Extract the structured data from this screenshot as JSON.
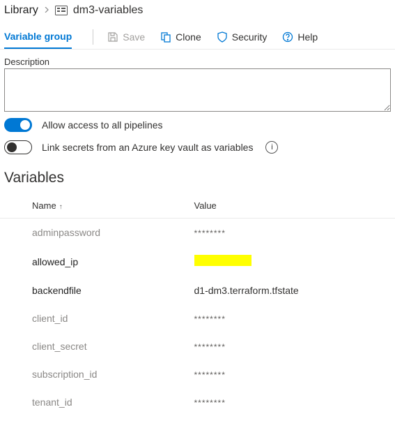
{
  "breadcrumb": {
    "root": "Library",
    "current": "dm3-variables"
  },
  "toolbar": {
    "tab_label": "Variable group",
    "save_label": "Save",
    "clone_label": "Clone",
    "security_label": "Security",
    "help_label": "Help"
  },
  "description": {
    "label": "Description",
    "value": ""
  },
  "toggles": {
    "allow_access": {
      "label": "Allow access to all pipelines",
      "on": true
    },
    "keyvault": {
      "label": "Link secrets from an Azure key vault as variables",
      "on": false
    }
  },
  "variables": {
    "title": "Variables",
    "columns": {
      "name": "Name",
      "value": "Value"
    },
    "rows": [
      {
        "name": "adminpassword",
        "masked": true,
        "value": "********"
      },
      {
        "name": "allowed_ip",
        "masked": false,
        "highlighted": true,
        "value": ""
      },
      {
        "name": "backendfile",
        "masked": false,
        "value": "d1-dm3.terraform.tfstate"
      },
      {
        "name": "client_id",
        "masked": true,
        "value": "********"
      },
      {
        "name": "client_secret",
        "masked": true,
        "value": "********"
      },
      {
        "name": "subscription_id",
        "masked": true,
        "value": "********"
      },
      {
        "name": "tenant_id",
        "masked": true,
        "value": "********"
      }
    ]
  }
}
